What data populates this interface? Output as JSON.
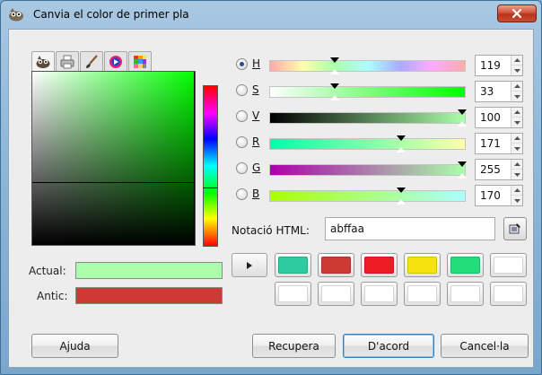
{
  "window": {
    "title": "Canvia el color de primer pla",
    "close_glyph": "✕"
  },
  "tabs": [
    {
      "name": "gimp-icon"
    },
    {
      "name": "printer-icon"
    },
    {
      "name": "brush-icon"
    },
    {
      "name": "color-wheel-icon"
    },
    {
      "name": "palette-icon"
    }
  ],
  "swatches": {
    "current_label": "Actual:",
    "current_color": "#abffaa",
    "old_label": "Antic:",
    "old_color": "#cc3b33"
  },
  "channels": [
    {
      "key": "h",
      "label": "H",
      "value": "119",
      "selected": true,
      "level": 0.33
    },
    {
      "key": "s",
      "label": "S",
      "value": "33",
      "selected": false,
      "level": 0.33
    },
    {
      "key": "v",
      "label": "V",
      "value": "100",
      "selected": false,
      "level": 1.0
    },
    {
      "key": "r",
      "label": "R",
      "value": "171",
      "selected": false,
      "level": 0.67
    },
    {
      "key": "g",
      "label": "G",
      "value": "255",
      "selected": false,
      "level": 1.0
    },
    {
      "key": "b",
      "label": "B",
      "value": "170",
      "selected": false,
      "level": 0.67
    }
  ],
  "html_notation": {
    "label": "Notació HTML:",
    "value": "abffaa"
  },
  "history": {
    "colors": [
      "#2ecba0",
      "#cc3b33",
      "#ee1c24",
      "#f6e20c",
      "#22dd7a",
      "#ffffff",
      "#ffffff",
      "#ffffff",
      "#ffffff",
      "#ffffff",
      "#ffffff",
      "#ffffff"
    ]
  },
  "buttons": {
    "help": "Ajuda",
    "reset": "Recupera",
    "ok": "D'acord",
    "cancel": "Cancel·la"
  }
}
